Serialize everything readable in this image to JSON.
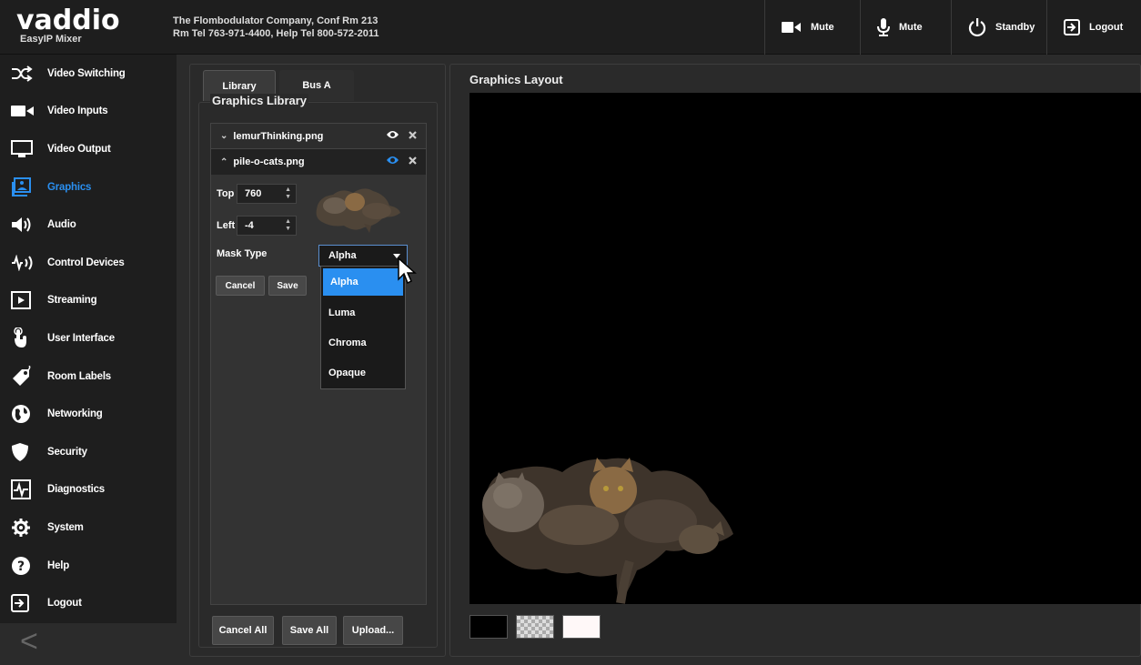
{
  "header": {
    "logo": "vaddio",
    "product": "EasyIP Mixer",
    "room_line1": "The Flombodulator Company, Conf Rm 213",
    "room_line2": "Rm Tel 763-971-4400, Help Tel 800-572-2011",
    "buttons": [
      {
        "icon": "video-camera-icon",
        "label": "Mute"
      },
      {
        "icon": "microphone-icon",
        "label": "Mute"
      },
      {
        "icon": "power-icon",
        "label": "Standby"
      },
      {
        "icon": "logout-icon",
        "label": "Logout"
      }
    ]
  },
  "sidebar": {
    "items": [
      {
        "label": "Video Switching",
        "icon": "shuffle-icon"
      },
      {
        "label": "Video Inputs",
        "icon": "video-camera-icon"
      },
      {
        "label": "Video Output",
        "icon": "monitor-icon"
      },
      {
        "label": "Graphics",
        "icon": "graphics-icon",
        "active": true
      },
      {
        "label": "Audio",
        "icon": "speaker-icon"
      },
      {
        "label": "Control Devices",
        "icon": "signal-icon"
      },
      {
        "label": "Streaming",
        "icon": "play-icon"
      },
      {
        "label": "User Interface",
        "icon": "touch-icon"
      },
      {
        "label": "Room Labels",
        "icon": "tag-icon"
      },
      {
        "label": "Networking",
        "icon": "globe-icon"
      },
      {
        "label": "Security",
        "icon": "shield-icon"
      },
      {
        "label": "Diagnostics",
        "icon": "pulse-icon"
      },
      {
        "label": "System",
        "icon": "gear-icon"
      },
      {
        "label": "Help",
        "icon": "help-icon"
      },
      {
        "label": "Logout",
        "icon": "logout-icon"
      }
    ],
    "collapse_glyph": "<"
  },
  "tabs": [
    "Library",
    "Bus A"
  ],
  "library": {
    "title": "Graphics Library",
    "items": [
      {
        "name": "lemurThinking.png",
        "expanded": false
      },
      {
        "name": "pile-o-cats.png",
        "expanded": true
      }
    ],
    "top_label": "Top",
    "top_value": "760",
    "left_label": "Left",
    "left_value": "-4",
    "mask_label": "Mask Type",
    "mask_value": "Alpha",
    "mask_options": [
      "Alpha",
      "Luma",
      "Chroma",
      "Opaque"
    ],
    "cancel": "Cancel",
    "save": "Save",
    "cancel_all": "Cancel All",
    "save_all": "Save All",
    "upload": "Upload..."
  },
  "layout": {
    "title": "Graphics Layout",
    "background_swatches": [
      "#000000",
      "checker",
      "#fff8f8"
    ]
  },
  "colors": {
    "accent": "#2a8ff0",
    "background": "#2b2b2b"
  }
}
